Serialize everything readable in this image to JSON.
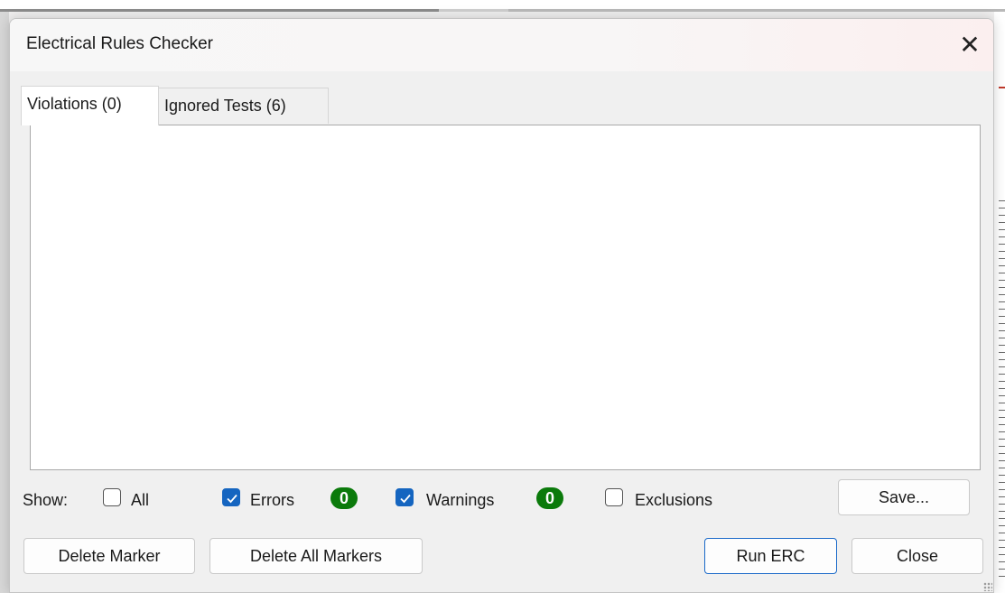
{
  "dialog": {
    "title": "Electrical Rules Checker",
    "close_glyph": "✕"
  },
  "tabs": [
    {
      "label": "Violations (0)",
      "active": true
    },
    {
      "label": "Ignored Tests (6)",
      "active": false
    }
  ],
  "filters": {
    "show_label": "Show:",
    "all": {
      "label": "All",
      "checked": false
    },
    "errors": {
      "label": "Errors",
      "checked": true,
      "count": "0"
    },
    "warnings": {
      "label": "Warnings",
      "checked": true,
      "count": "0"
    },
    "exclusions": {
      "label": "Exclusions",
      "checked": false
    }
  },
  "buttons": {
    "save": "Save...",
    "delete_marker": "Delete Marker",
    "delete_all_markers": "Delete All Markers",
    "run_erc": "Run ERC",
    "close": "Close"
  },
  "colors": {
    "accent": "#1565c0",
    "badge": "#0b7a0b"
  },
  "icons": {
    "close": "close-icon",
    "checkbox_checked": "checkmark-icon",
    "resize": "resize-grip-icon"
  }
}
